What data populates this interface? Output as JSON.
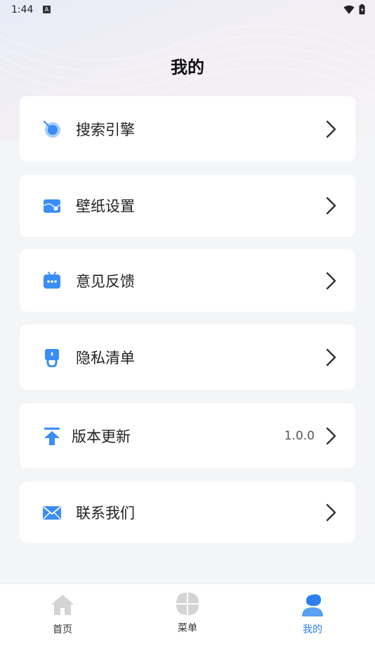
{
  "status_bar": {
    "time": "1:44",
    "notification_badge": "A"
  },
  "page": {
    "title": "我的"
  },
  "menu": [
    {
      "id": "search-engine",
      "label": "搜索引擎",
      "icon": "target-icon",
      "value": ""
    },
    {
      "id": "wallpaper",
      "label": "壁纸设置",
      "icon": "wallpaper-icon",
      "value": ""
    },
    {
      "id": "feedback",
      "label": "意见反馈",
      "icon": "chat-icon",
      "value": ""
    },
    {
      "id": "privacy",
      "label": "隐私清单",
      "icon": "privacy-icon",
      "value": ""
    },
    {
      "id": "update",
      "label": "版本更新",
      "icon": "upload-icon",
      "value": "1.0.0"
    },
    {
      "id": "contact",
      "label": "联系我们",
      "icon": "mail-icon",
      "value": ""
    }
  ],
  "tabbar": {
    "home": "首页",
    "menu": "菜单",
    "mine": "我的"
  },
  "colors": {
    "accent": "#2d7ff0",
    "icon_blue": "#3a8df5",
    "inactive": "#d4d4d4"
  }
}
